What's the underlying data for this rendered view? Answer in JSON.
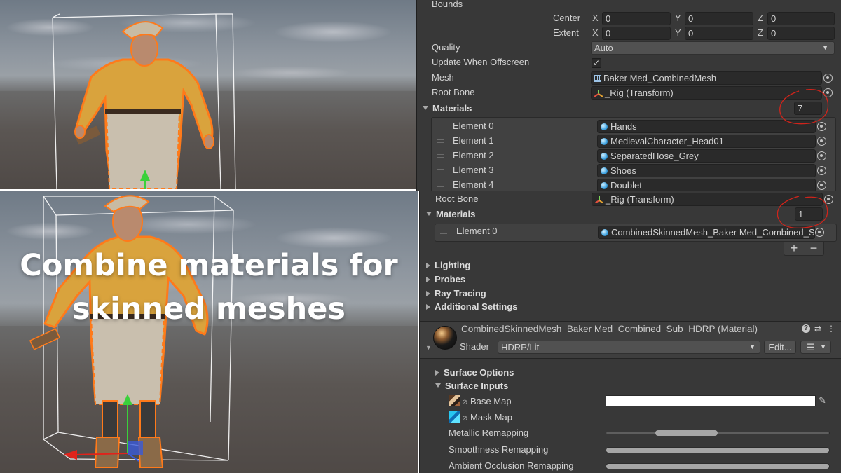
{
  "overlay": {
    "title": "Combine materials for skinned meshes"
  },
  "inspector_top": {
    "bounds_label": "Bounds",
    "center": {
      "label": "Center",
      "x": "0",
      "y": "0",
      "z": "0"
    },
    "extent": {
      "label": "Extent",
      "x": "0",
      "y": "0",
      "z": "0"
    },
    "axis": {
      "x": "X",
      "y": "Y",
      "z": "Z"
    },
    "quality": {
      "label": "Quality",
      "value": "Auto"
    },
    "update_offscreen": {
      "label": "Update When Offscreen",
      "checked": "✓"
    },
    "mesh": {
      "label": "Mesh",
      "value": "Baker Med_CombinedMesh"
    },
    "root_bone": {
      "label": "Root Bone",
      "value": "_Rig (Transform)"
    },
    "materials": {
      "label": "Materials",
      "count": "7",
      "elements": [
        {
          "label": "Element 0",
          "value": "Hands"
        },
        {
          "label": "Element 1",
          "value": "MedievalCharacter_Head01"
        },
        {
          "label": "Element 2",
          "value": "SeparatedHose_Grey"
        },
        {
          "label": "Element 3",
          "value": "Shoes"
        },
        {
          "label": "Element 4",
          "value": "Doublet"
        }
      ]
    }
  },
  "inspector_bottom": {
    "root_bone": {
      "label": "Root Bone",
      "value": "_Rig (Transform)"
    },
    "materials": {
      "label": "Materials",
      "count": "1",
      "elements": [
        {
          "label": "Element 0",
          "value": "CombinedSkinnedMesh_Baker Med_Combined_S"
        }
      ],
      "add": "+",
      "remove": "−"
    },
    "sections": [
      "Lighting",
      "Probes",
      "Ray Tracing",
      "Additional Settings"
    ],
    "material_header": {
      "title": "CombinedSkinnedMesh_Baker Med_Combined_Sub_HDRP (Material)",
      "shader_label": "Shader",
      "shader_value": "HDRP/Lit",
      "edit_label": "Edit...",
      "help_icon": "?"
    },
    "surface_options": "Surface Options",
    "surface_inputs": "Surface Inputs",
    "base_map": "Base Map",
    "mask_map": "Mask Map",
    "metallic_remapping": {
      "label": "Metallic Remapping",
      "min": 0.22,
      "max": 0.5
    },
    "smoothness_remapping": {
      "label": "Smoothness Remapping",
      "min": 0.0,
      "max": 1.0
    },
    "ao_remapping": {
      "label": "Ambient Occlusion Remapping",
      "min": 0.0,
      "max": 1.0
    }
  },
  "colors": {
    "panel_bg": "#383838",
    "field_bg": "#2a2a2a",
    "annotation_red": "#d0241b",
    "selection_outline": "#ff7a1a"
  }
}
